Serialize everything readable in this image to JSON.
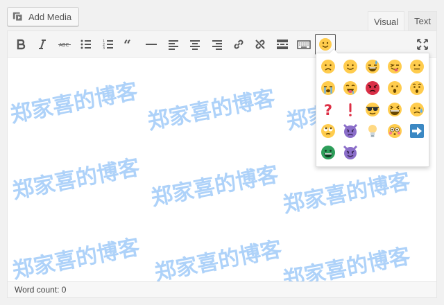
{
  "toolbar": {
    "add_media_label": "Add Media"
  },
  "tabs": [
    {
      "label": "Visual",
      "active": true
    },
    {
      "label": "Text",
      "active": false
    }
  ],
  "editor_buttons": [
    "bold",
    "italic",
    "strikethrough",
    "bulleted-list",
    "numbered-list",
    "blockquote",
    "horizontal-line",
    "align-left",
    "align-center",
    "align-right",
    "link",
    "unlink",
    "read-more",
    "toolbar-toggle",
    "emoji"
  ],
  "watermark": "郑家喜的博客",
  "status": {
    "word_count": "Word count: 0"
  },
  "emoji_panel": {
    "items": [
      "frowning",
      "smiling",
      "grinning-sweat",
      "winking-tongue",
      "neutral",
      "crying",
      "drooling",
      "pouting",
      "surprised",
      "hushed",
      "question-mark",
      "exclamation-mark",
      "sunglasses",
      "laughing",
      "worried-sweat",
      "rolling-eyes",
      "imp",
      "light-bulb",
      "flushed",
      "arrow-right",
      "grinning-green",
      "smiling-imp"
    ]
  },
  "colors": {
    "accent": "#0073aa",
    "watermark": "#78b4f5",
    "emoji_yellow": "#ffcc4d",
    "imp_purple": "#8b6ec9"
  }
}
